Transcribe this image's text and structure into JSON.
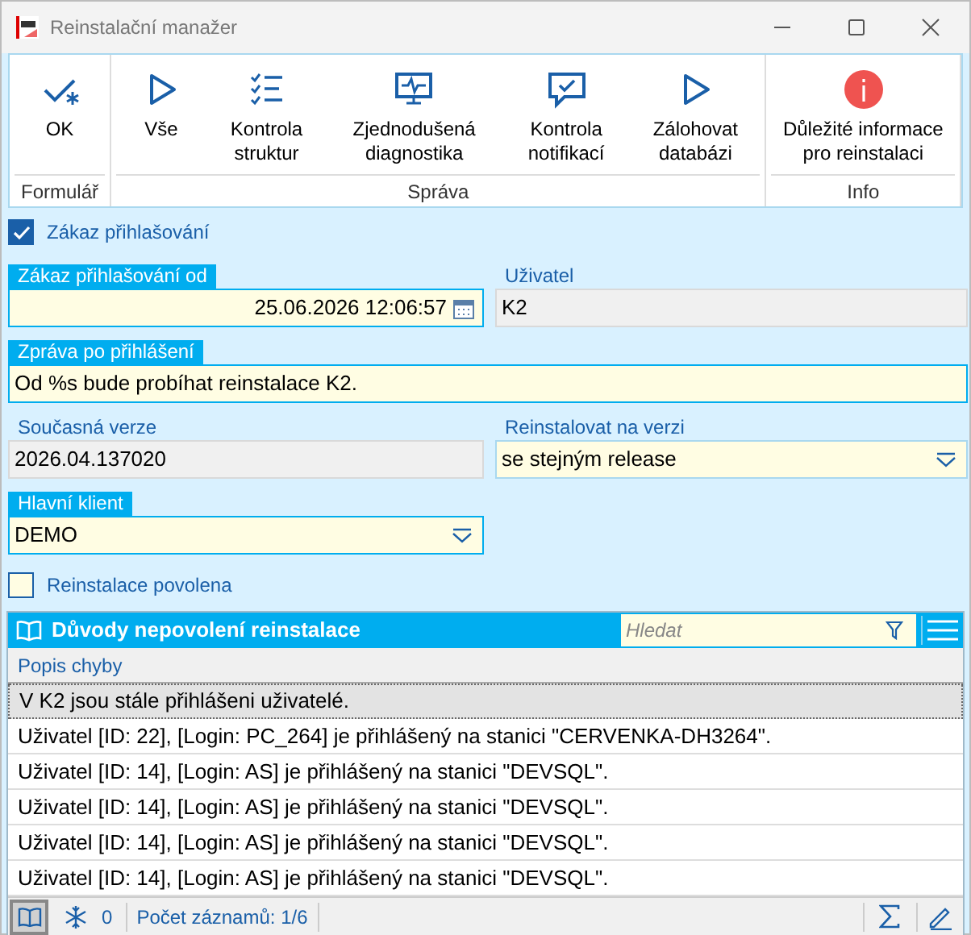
{
  "window": {
    "title": "Reinstalační manažer"
  },
  "ribbon": {
    "groups": [
      {
        "label": "Formulář",
        "buttons": [
          {
            "kind": "ok",
            "label": "OK"
          }
        ]
      },
      {
        "label": "Správa",
        "buttons": [
          {
            "kind": "play",
            "label": "Vše"
          },
          {
            "kind": "checklist",
            "label": "Kontrola struktur"
          },
          {
            "kind": "monitor",
            "label": "Zjednodušená diagnostika"
          },
          {
            "kind": "chat",
            "label": "Kontrola notifikací"
          },
          {
            "kind": "play",
            "label": "Zálohovat databázi"
          }
        ]
      },
      {
        "label": "Info",
        "buttons": [
          {
            "kind": "info",
            "label": "Důležité informace pro reinstalaci"
          }
        ]
      }
    ]
  },
  "login_block": {
    "label": "Zákaz přihlašování",
    "checked": true
  },
  "fields": {
    "block_from": {
      "label": "Zákaz přihlašování od",
      "value": "25.06.2026 12:06:57",
      "required": true
    },
    "user": {
      "label": "Uživatel",
      "value": "K2",
      "required": false
    },
    "message": {
      "label": "Zpráva po přihlášení",
      "value": "Od %s bude probíhat reinstalace K2.",
      "required": true
    },
    "current_version": {
      "label": "Současná verze",
      "value": "2026.04.137020",
      "required": false
    },
    "reinstall_to": {
      "label": "Reinstalovat na verzi",
      "value": "se stejným release",
      "required": false
    },
    "main_client": {
      "label": "Hlavní klient",
      "value": "DEMO",
      "required": true
    }
  },
  "reinstall_allowed": {
    "label": "Reinstalace povolena",
    "checked": false
  },
  "grid": {
    "title": "Důvody nepovolení reinstalace",
    "search": {
      "placeholder": "Hledat"
    },
    "columns": [
      "Popis chyby"
    ],
    "rows": [
      {
        "text": "V K2 jsou stále přihlášeni uživatelé.",
        "selected": true
      },
      {
        "text": "Uživatel [ID: 22], [Login: PC_264] je přihlášený na stanici \"CERVENKA-DH3264\".",
        "selected": false
      },
      {
        "text": "Uživatel [ID: 14], [Login: AS] je přihlášený na stanici \"DEVSQL\".",
        "selected": false
      },
      {
        "text": "Uživatel [ID: 14], [Login: AS] je přihlášený na stanici \"DEVSQL\".",
        "selected": false
      },
      {
        "text": "Uživatel [ID: 14], [Login: AS] je přihlášený na stanici \"DEVSQL\".",
        "selected": false
      },
      {
        "text": "Uživatel [ID: 14], [Login: AS] je přihlášený na stanici \"DEVSQL\".",
        "selected": false
      }
    ]
  },
  "status_bar": {
    "frozen_count": "0",
    "record_count": "Počet záznamů: 1/6"
  }
}
